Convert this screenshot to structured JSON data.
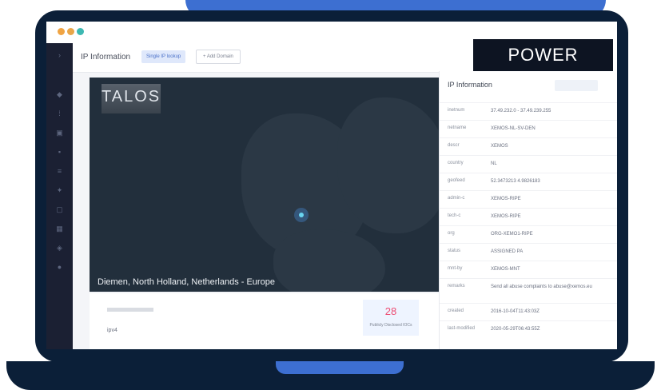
{
  "app": {
    "title": "IP Information",
    "tab_badge": "Single IP lookup",
    "add_button": "+ Add Domain",
    "brand": "POWER DMARC"
  },
  "map": {
    "logo": "TALOS",
    "location": "Diemen, North Holland, Netherlands - Europe"
  },
  "stats": {
    "sub_label": "ipv4",
    "count_value": "28",
    "count_label": "Publicly Disclosed IOCs"
  },
  "info": {
    "title": "IP Information",
    "rows": [
      {
        "key": "inetnum",
        "value": "37.49.232.0 - 37.49.239.255"
      },
      {
        "key": "netname",
        "value": "XEMOS-NL-SV-DEN"
      },
      {
        "key": "descr",
        "value": "XEMOS"
      },
      {
        "key": "country",
        "value": "NL"
      },
      {
        "key": "geofeed",
        "value": "52.3473213 4.9826183"
      },
      {
        "key": "admin-c",
        "value": "XEMOS-RIPE"
      },
      {
        "key": "tech-c",
        "value": "XEMOS-RIPE"
      },
      {
        "key": "org",
        "value": "ORG-XEMO1-RIPE"
      },
      {
        "key": "status",
        "value": "ASSIGNED PA"
      },
      {
        "key": "mnt-by",
        "value": "XEMOS-MNT"
      },
      {
        "key": "remarks",
        "value": "Send all abuse complaints to abuse@xemos.eu"
      },
      {
        "key": "created",
        "value": "2016-10-04T11:43:03Z"
      },
      {
        "key": "last-modified",
        "value": "2020-05-29T06:43:55Z"
      }
    ]
  },
  "colors": {
    "laptop": "#0b1f38",
    "accent": "#3d6fd1",
    "map_bg": "#222f3c",
    "marker": "#69d4ef",
    "count": "#ed4d73"
  }
}
